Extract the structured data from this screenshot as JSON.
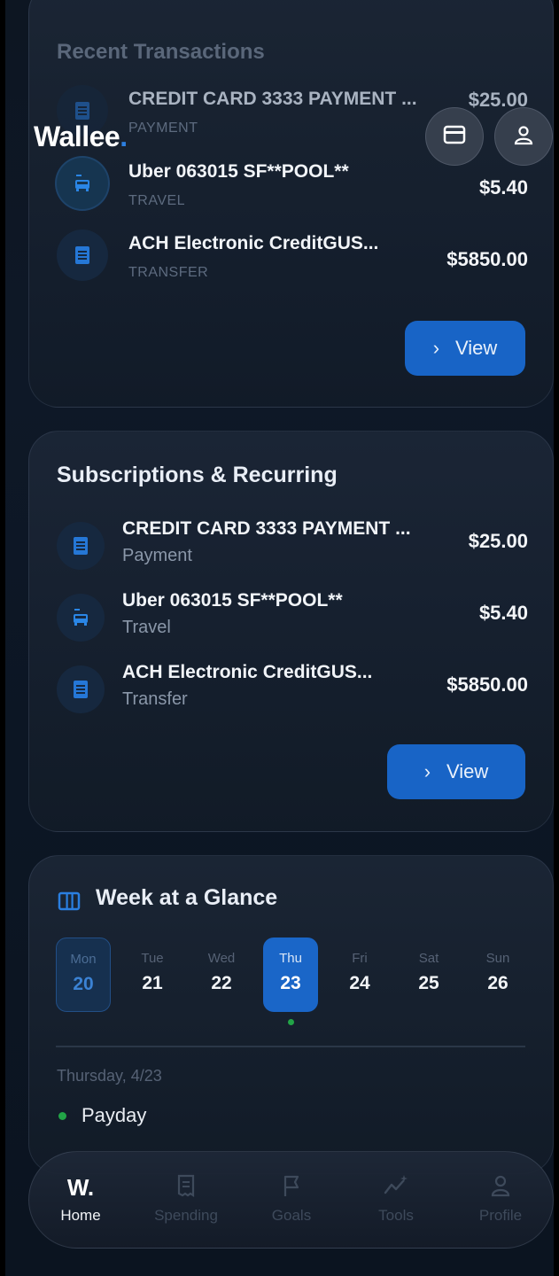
{
  "brand": {
    "name": "Wallee",
    "dot": "."
  },
  "recent": {
    "title": "Recent Transactions",
    "items": [
      {
        "name": "CREDIT CARD 3333 PAYMENT ...",
        "category": "PAYMENT",
        "amount": "$25.00",
        "icon": "receipt-icon"
      },
      {
        "name": "Uber 063015 SF**POOL**",
        "category": "TRAVEL",
        "amount": "$5.40",
        "icon": "taxi-icon"
      },
      {
        "name": "ACH Electronic CreditGUS...",
        "category": "TRANSFER",
        "amount": "$5850.00",
        "icon": "receipt-icon"
      }
    ],
    "view_label": "View"
  },
  "subs": {
    "title": "Subscriptions & Recurring",
    "items": [
      {
        "name": "CREDIT CARD 3333 PAYMENT ...",
        "category": "Payment",
        "amount": "$25.00",
        "icon": "receipt-icon"
      },
      {
        "name": "Uber 063015 SF**POOL**",
        "category": "Travel",
        "amount": "$5.40",
        "icon": "taxi-icon"
      },
      {
        "name": "ACH Electronic CreditGUS...",
        "category": "Transfer",
        "amount": "$5850.00",
        "icon": "receipt-icon"
      }
    ],
    "view_label": "View"
  },
  "week": {
    "title": "Week at a Glance",
    "days": [
      {
        "name": "Mon",
        "date": "20"
      },
      {
        "name": "Tue",
        "date": "21"
      },
      {
        "name": "Wed",
        "date": "22"
      },
      {
        "name": "Thu",
        "date": "23"
      },
      {
        "name": "Fri",
        "date": "24"
      },
      {
        "name": "Sat",
        "date": "25"
      },
      {
        "name": "Sun",
        "date": "26"
      }
    ],
    "selected_label": "Thursday, 4/23",
    "event": "Payday"
  },
  "nav": {
    "home_glyph": "W.",
    "items": [
      {
        "label": "Home"
      },
      {
        "label": "Spending"
      },
      {
        "label": "Goals"
      },
      {
        "label": "Tools"
      },
      {
        "label": "Profile"
      }
    ]
  },
  "colors": {
    "accent": "#1864c6",
    "event_dot": "#22a447"
  }
}
